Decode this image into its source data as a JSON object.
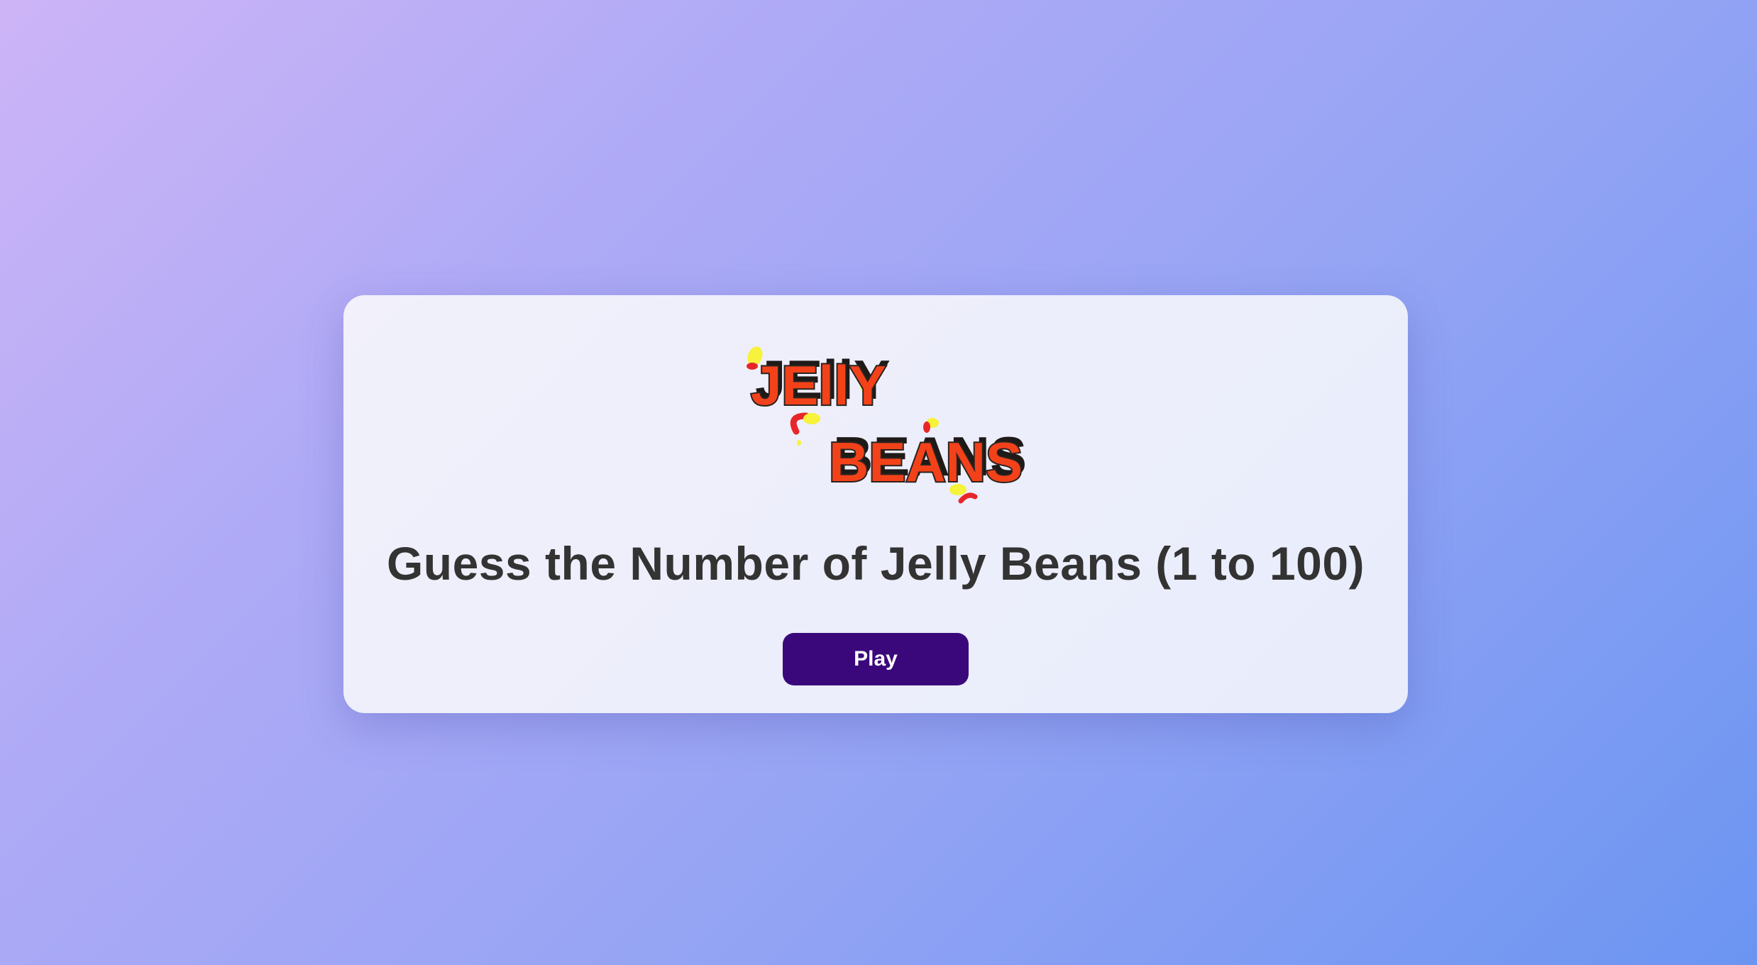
{
  "logo": {
    "line1": "JEllY",
    "line2": "BEANS",
    "colors": {
      "fill": "#f3421a",
      "outline": "#2a2420",
      "bean_yellow": "#f7f23a",
      "bean_red": "#e8262a"
    }
  },
  "game": {
    "title": "Guess the Number of Jelly Beans (1 to 100)",
    "play_label": "Play"
  },
  "colors": {
    "background_start": "#cdb4f7",
    "background_end": "#6b95f2",
    "card": "#eef0fb",
    "title_text": "#333333",
    "button": "#3b087c",
    "button_text": "#ffffff"
  }
}
